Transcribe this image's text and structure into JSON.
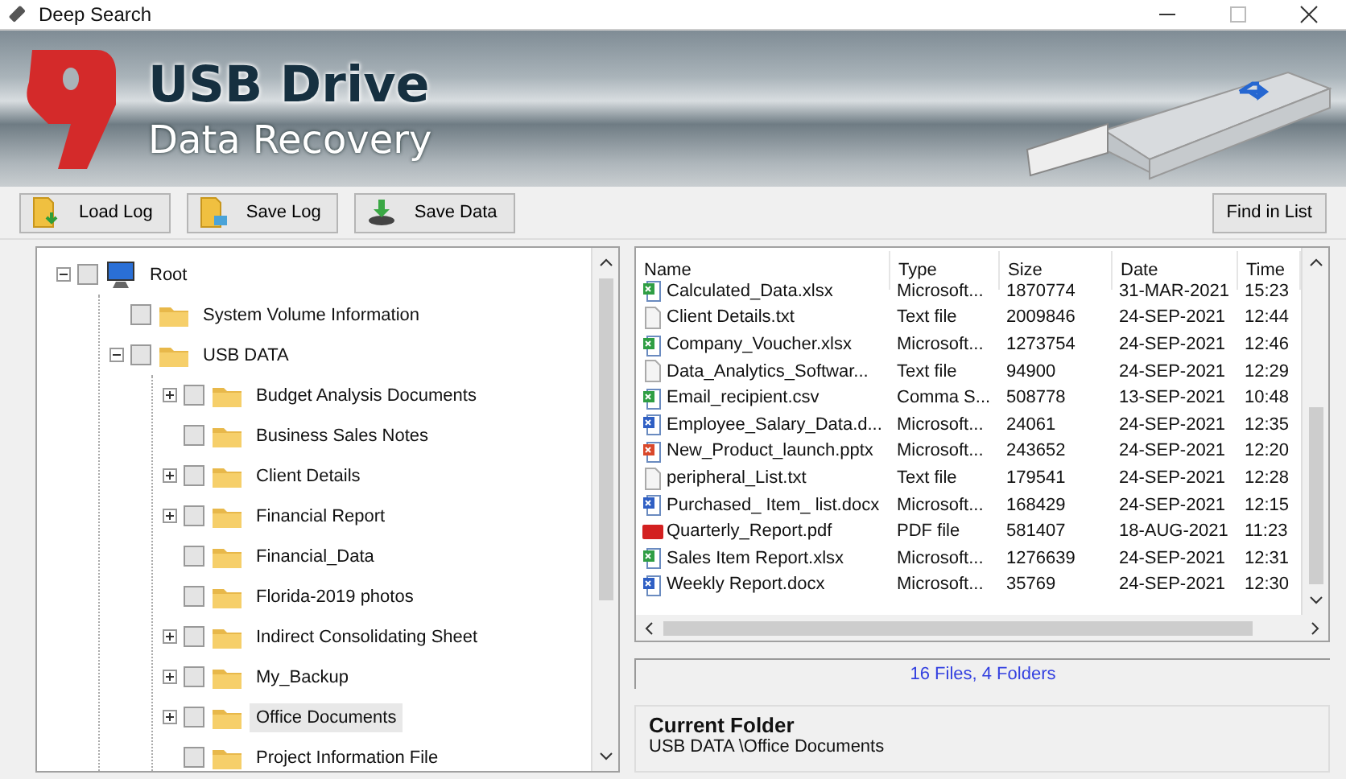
{
  "window": {
    "title": "Deep Search"
  },
  "banner": {
    "title": "USB Drive",
    "subtitle": "Data Recovery"
  },
  "toolbar": {
    "buttons": [
      {
        "label": "Load Log",
        "kind": "load"
      },
      {
        "label": "Save Log",
        "kind": "save"
      },
      {
        "label": "Save Data",
        "kind": "data"
      }
    ],
    "find_button": "Find in List"
  },
  "tree": [
    {
      "label": "Root",
      "kind": "computer",
      "expanded": true,
      "checked": false,
      "selected": false,
      "children": [
        {
          "label": "System Volume Information",
          "kind": "folder",
          "checked": false,
          "selected": false
        },
        {
          "label": "USB DATA",
          "kind": "folder",
          "expanded": true,
          "checked": false,
          "selected": false,
          "children": [
            {
              "label": "Budget Analysis Documents",
              "kind": "folder",
              "expanded": false,
              "checked": false,
              "selected": false
            },
            {
              "label": "Business Sales Notes",
              "kind": "folder",
              "checked": false,
              "selected": false
            },
            {
              "label": "Client Details",
              "kind": "folder",
              "expanded": false,
              "checked": false,
              "selected": false
            },
            {
              "label": "Financial Report",
              "kind": "folder",
              "expanded": false,
              "checked": false,
              "selected": false
            },
            {
              "label": "Financial_Data",
              "kind": "folder",
              "checked": false,
              "selected": false
            },
            {
              "label": "Florida-2019 photos",
              "kind": "folder",
              "checked": false,
              "selected": false
            },
            {
              "label": "Indirect Consolidating Sheet",
              "kind": "folder",
              "expanded": false,
              "checked": false,
              "selected": false
            },
            {
              "label": "My_Backup",
              "kind": "folder",
              "expanded": false,
              "checked": false,
              "selected": false
            },
            {
              "label": "Office Documents",
              "kind": "folder",
              "expanded": false,
              "checked": false,
              "selected": true
            },
            {
              "label": "Project Information File",
              "kind": "folder",
              "checked": false,
              "selected": false
            }
          ]
        }
      ]
    }
  ],
  "files": {
    "columns": [
      "Name",
      "Type",
      "Size",
      "Date",
      "Time"
    ],
    "rows": [
      {
        "kind": "xlsx",
        "name": "Calculated_Data.xlsx",
        "type": "Microsoft...",
        "size": "1870774",
        "date": "31-MAR-2021",
        "time": "15:23"
      },
      {
        "kind": "txt",
        "name": "Client Details.txt",
        "type": "Text file",
        "size": "2009846",
        "date": "24-SEP-2021",
        "time": "12:44"
      },
      {
        "kind": "xlsx",
        "name": "Company_Voucher.xlsx",
        "type": "Microsoft...",
        "size": "1273754",
        "date": "24-SEP-2021",
        "time": "12:46"
      },
      {
        "kind": "txt",
        "name": "Data_Analytics_Softwar...",
        "type": "Text file",
        "size": "94900",
        "date": "24-SEP-2021",
        "time": "12:29"
      },
      {
        "kind": "xlsx",
        "name": "Email_recipient.csv",
        "type": "Comma S...",
        "size": "508778",
        "date": "13-SEP-2021",
        "time": "10:48"
      },
      {
        "kind": "docx",
        "name": "Employee_Salary_Data.d...",
        "type": "Microsoft...",
        "size": "24061",
        "date": "24-SEP-2021",
        "time": "12:35"
      },
      {
        "kind": "pptx",
        "name": "New_Product_launch.pptx",
        "type": "Microsoft...",
        "size": "243652",
        "date": "24-SEP-2021",
        "time": "12:20"
      },
      {
        "kind": "txt",
        "name": "peripheral_List.txt",
        "type": "Text file",
        "size": "179541",
        "date": "24-SEP-2021",
        "time": "12:28"
      },
      {
        "kind": "docx",
        "name": "Purchased_ Item_ list.docx",
        "type": "Microsoft...",
        "size": "168429",
        "date": "24-SEP-2021",
        "time": "12:15"
      },
      {
        "kind": "pdf",
        "name": "Quarterly_Report.pdf",
        "type": "PDF file",
        "size": "581407",
        "date": "18-AUG-2021",
        "time": "11:23"
      },
      {
        "kind": "xlsx",
        "name": "Sales Item Report.xlsx",
        "type": "Microsoft...",
        "size": "1276639",
        "date": "24-SEP-2021",
        "time": "12:31"
      },
      {
        "kind": "docx",
        "name": "Weekly Report.docx",
        "type": "Microsoft...",
        "size": "35769",
        "date": "24-SEP-2021",
        "time": "12:30"
      }
    ]
  },
  "status": "16 Files, 4 Folders",
  "current_folder": {
    "title": "Current Folder",
    "path": "USB DATA \\Office Documents"
  }
}
